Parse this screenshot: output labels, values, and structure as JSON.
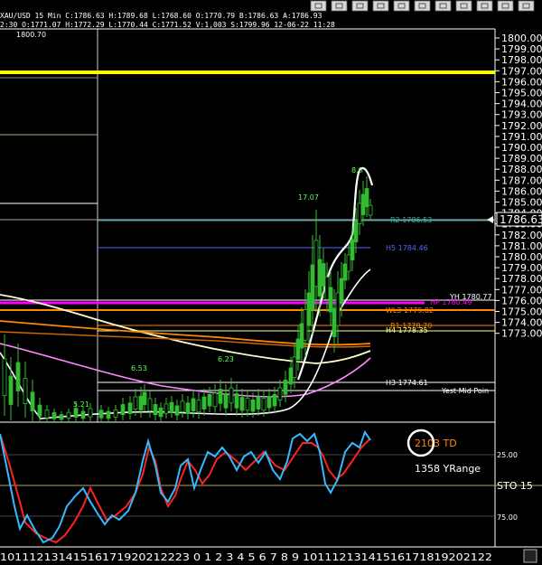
{
  "toolbar": {
    "icon_names": [
      "chart-style-icon",
      "crosshair-icon",
      "zoom-icon",
      "grid-icon",
      "table-icon",
      "ohlc-icon",
      "line-icon",
      "settings-icon",
      "window-icon",
      "cascade-icon",
      "expand-icon"
    ]
  },
  "header": {
    "symbol_line": "XAU/USD  15 Min  C:1786.63  H:1789.68  L:1768.60  O:1770.79  B:1786.63  A:1786.93",
    "line2": "2:30  O:1771.07  H:1772.29  L:1770.44  C:1771.52  V:1,003  S:1799.96  12-06-22  11:28"
  },
  "price_axis": {
    "ticks": [
      "1800.00",
      "1799.00",
      "1798.00",
      "1797.00",
      "1796.00",
      "1795.00",
      "1794.00",
      "1793.00",
      "1792.00",
      "1791.00",
      "1790.00",
      "1789.00",
      "1788.00",
      "1787.00",
      "1786.00",
      "1785.00",
      "1784.00",
      "1783.00",
      "1782.00",
      "1781.00",
      "1780.00",
      "1779.00",
      "1778.00",
      "1777.00",
      "1776.00",
      "1775.00",
      "1774.00",
      "1773.00"
    ],
    "current_price": "1786.63"
  },
  "chart_labels": {
    "top_price": "1800.70",
    "swing_1": "17.07",
    "swing_2": "8.0",
    "swing_3": "6.53",
    "swing_4": "6.23",
    "swing_5": "5.21"
  },
  "levels": {
    "r2": "R2 1786.53",
    "h5": "H5 1784.46",
    "yh": "YH 1780.77",
    "hp": "HP 1780.49",
    "wl3": "WL3 1779.82",
    "r1": "R1 1778.70",
    "h4": "H4 1778.35",
    "h3": "H3 1774.61",
    "yest_mid": "Yest Mid Poin"
  },
  "indicator": {
    "td_value": "2103 TD",
    "yrange": "1358 YRange",
    "sto_label": "STO  15",
    "level_25": "25.00",
    "level_75": "75.00"
  },
  "time_axis": {
    "labels": "10111213141516171920212223  0  1  2  3  4  5  6  7  8  9 10111213141516171819202122"
  },
  "colors": {
    "yellow_line": "#ffff00",
    "pivot_magenta": "#ff00ff",
    "stoch_blue": "#33bbff",
    "stoch_red": "#ff2222",
    "td_orange": "#ff8800"
  }
}
